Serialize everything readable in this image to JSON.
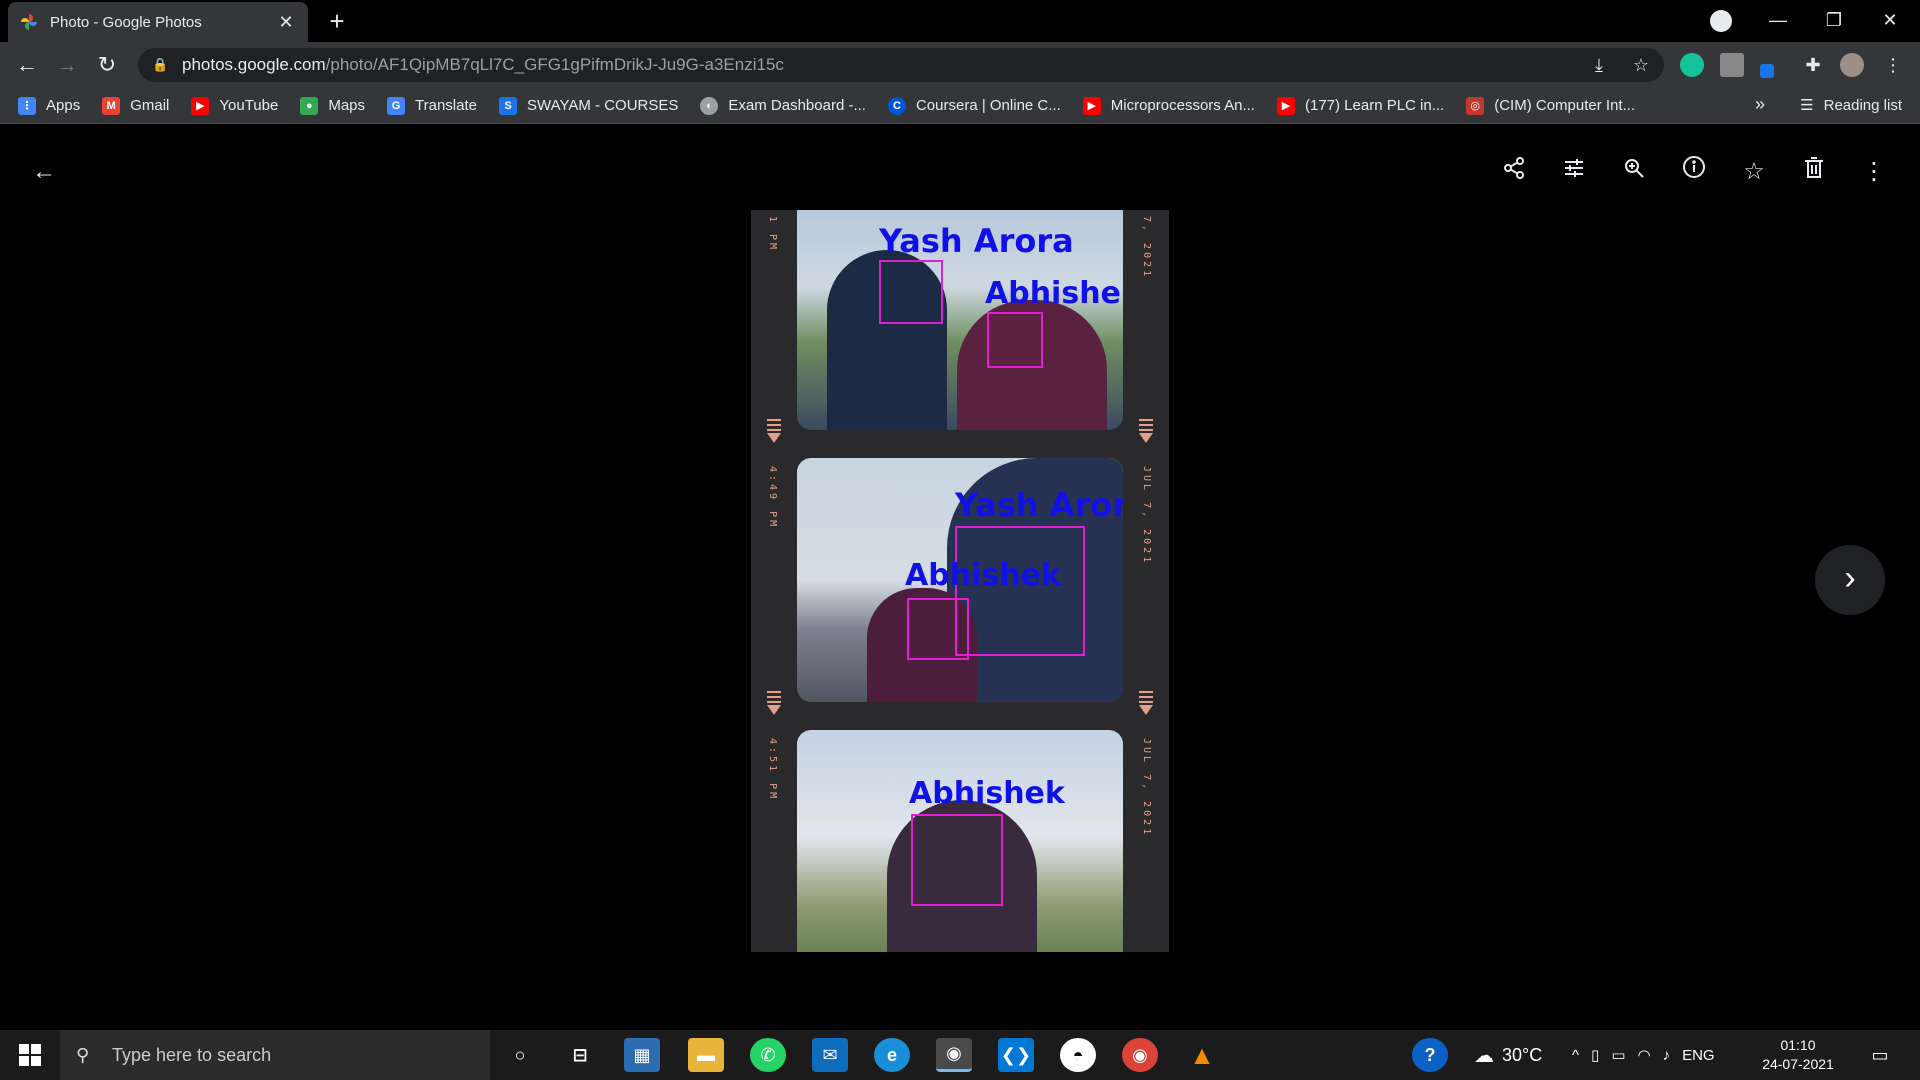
{
  "browser": {
    "tab_title": "Photo - Google Photos",
    "url_host": "photos.google.com",
    "url_path": "/photo/AF1QipMB7qLl7C_GFG1gPifmDrikJ-Ju9G-a3Enzi15c",
    "bookmarks": [
      {
        "label": "Apps",
        "icon": "apps-grid-icon",
        "color": "#4285f4"
      },
      {
        "label": "Gmail",
        "icon": "gmail-icon",
        "color": "#ea4335"
      },
      {
        "label": "YouTube",
        "icon": "youtube-icon",
        "color": "#ff0000"
      },
      {
        "label": "Maps",
        "icon": "maps-icon",
        "color": "#34a853"
      },
      {
        "label": "Translate",
        "icon": "translate-icon",
        "color": "#4285f4"
      },
      {
        "label": "SWAYAM - COURSES",
        "icon": "swayam-icon",
        "color": "#1a73e8"
      },
      {
        "label": "Exam Dashboard -...",
        "icon": "globe-icon",
        "color": "#9aa0a6"
      },
      {
        "label": "Coursera | Online C...",
        "icon": "coursera-icon",
        "color": "#0056d2"
      },
      {
        "label": "Microprocessors An...",
        "icon": "youtube-icon",
        "color": "#ff0000"
      },
      {
        "label": "(177) Learn PLC in...",
        "icon": "youtube-icon",
        "color": "#ff0000"
      },
      {
        "label": "(CIM) Computer Int...",
        "icon": "cim-icon",
        "color": "#c0392b"
      }
    ],
    "reading_list": "Reading list"
  },
  "viewer": {
    "actions": [
      "share-icon",
      "edit-sliders-icon",
      "zoom-icon",
      "info-icon",
      "star-icon",
      "delete-icon",
      "more-vert-icon"
    ],
    "frames": [
      {
        "time": "1 PM",
        "date": "7, 2021",
        "names": [
          "Yash Arora",
          "Abhishek"
        ]
      },
      {
        "time": "4:49 PM",
        "date": "JUL 7, 2021",
        "names": [
          "Yash Arora",
          "Abhishek"
        ]
      },
      {
        "time": "4:51 PM",
        "date": "JUL 7, 2021",
        "names": [
          "Abhishek"
        ]
      }
    ]
  },
  "taskbar": {
    "search_placeholder": "Type here to search",
    "weather": "30°C",
    "language": "ENG",
    "time": "01:10",
    "date": "24-07-2021"
  },
  "colors": {
    "accent_pink": "#e020d0",
    "label_blue": "#1010e8",
    "film_text": "#e3a08c"
  }
}
